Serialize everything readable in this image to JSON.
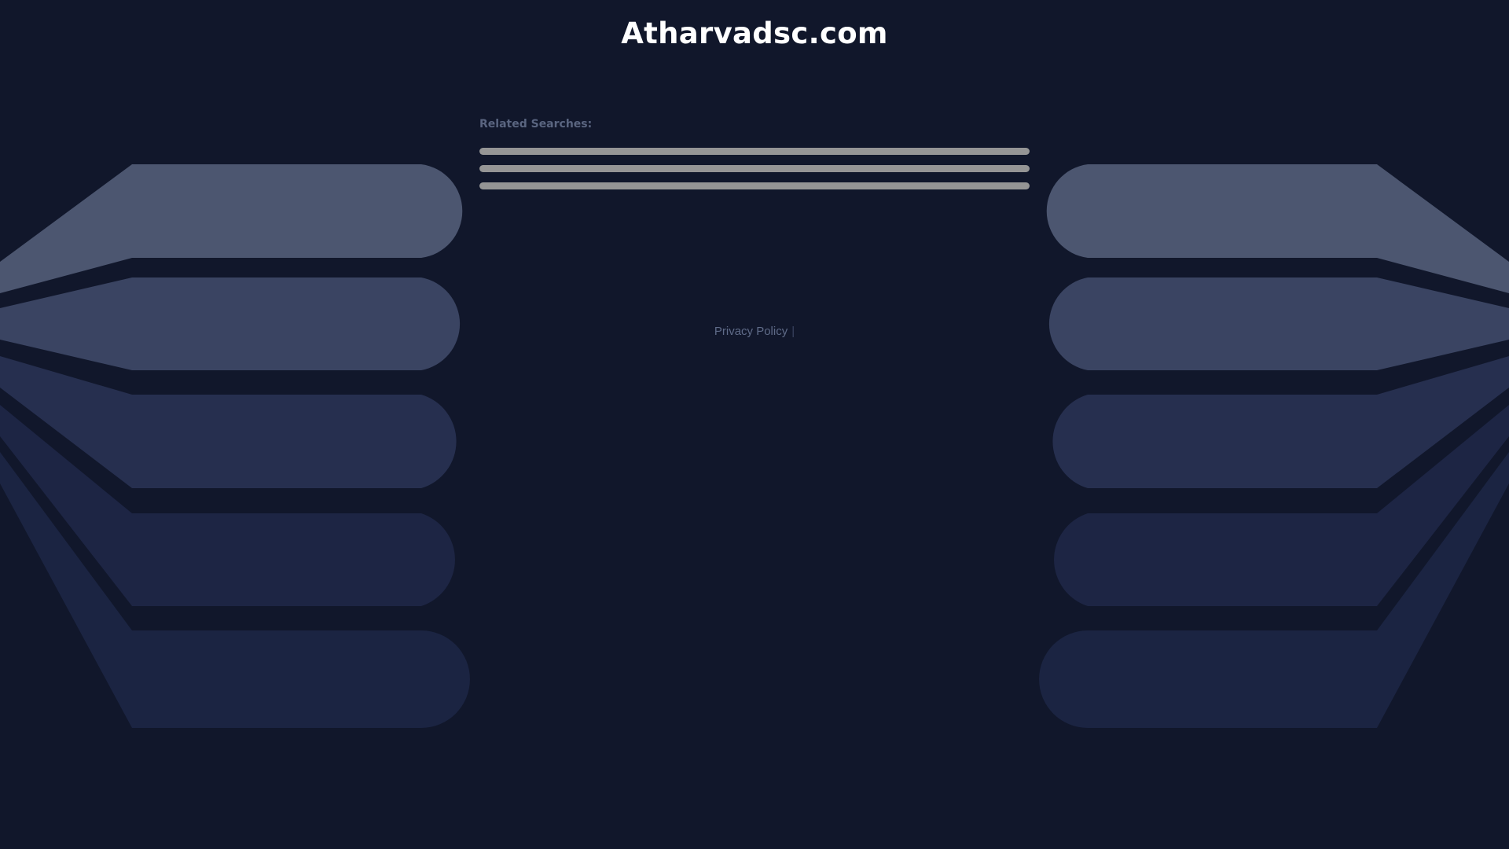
{
  "header": {
    "site_title": "Atharvadsc.com"
  },
  "related": {
    "heading": "Related Searches:",
    "items": [
      "",
      "",
      ""
    ]
  },
  "footer": {
    "privacy_label": "Privacy Policy",
    "separator": "|"
  },
  "colors": {
    "background": "#11172b",
    "title": "#ffffff",
    "placeholder_bar": "#959595",
    "muted_text": "#5a6580",
    "decor_tier_1": "#4c5670",
    "decor_tier_2": "#3a4462",
    "decor_tier_3": "#262f4f",
    "decor_tier_4": "#1d2544",
    "decor_tier_5": "#1b2442"
  },
  "icons": {
    "decorative_left": "layered-wing-shape",
    "decorative_right": "layered-wing-shape"
  }
}
